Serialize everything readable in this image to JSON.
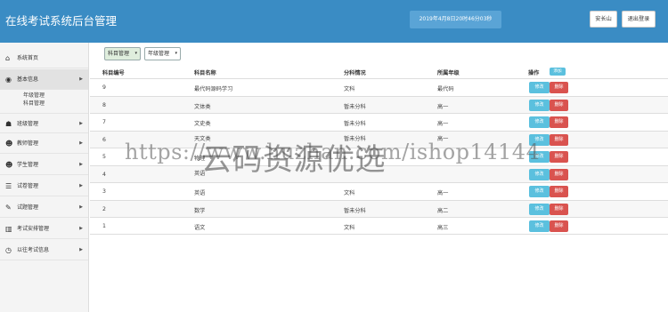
{
  "header": {
    "title": "在线考试系统后台管理",
    "datetime": "2019年4月8日20时46分03秒",
    "user_button": "安长山",
    "logout_button": "退出登录"
  },
  "sidebar": {
    "items": [
      {
        "label": "系统首页",
        "icon": "home-icon"
      },
      {
        "label": "基本信息",
        "icon": "info-icon",
        "subitems": [
          "年级管理",
          "科目管理"
        ]
      },
      {
        "label": "班级管理",
        "icon": "users-icon"
      },
      {
        "label": "教师管理",
        "icon": "teacher-icon"
      },
      {
        "label": "学生管理",
        "icon": "student-icon"
      },
      {
        "label": "试卷管理",
        "icon": "paper-icon"
      },
      {
        "label": "试题管理",
        "icon": "question-icon"
      },
      {
        "label": "考试安排管理",
        "icon": "schedule-icon"
      },
      {
        "label": "以往考试信息",
        "icon": "history-icon"
      }
    ]
  },
  "tabs": {
    "subject": "科目管理",
    "grade": "年级管理"
  },
  "table": {
    "headers": [
      "科目编号",
      "科目名称",
      "分科情况",
      "所属年级",
      "操作"
    ],
    "add_label": "添加",
    "edit_label": "修改",
    "delete_label": "删除",
    "rows": [
      {
        "id": "9",
        "name": "最代码源码学习",
        "division": "文科",
        "grade": "最代码"
      },
      {
        "id": "8",
        "name": "文体类",
        "division": "暂未分科",
        "grade": "高一"
      },
      {
        "id": "7",
        "name": "文史类",
        "division": "暂未分科",
        "grade": "高一"
      },
      {
        "id": "6",
        "name": "天文类",
        "division": "暂未分科",
        "grade": "高一"
      },
      {
        "id": "5",
        "name": "物理",
        "division": "",
        "grade": ""
      },
      {
        "id": "4",
        "name": "英语",
        "division": "",
        "grade": ""
      },
      {
        "id": "3",
        "name": "英语",
        "division": "文科",
        "grade": "高一"
      },
      {
        "id": "2",
        "name": "数学",
        "division": "暂未分科",
        "grade": "高二"
      },
      {
        "id": "1",
        "name": "语文",
        "division": "文科",
        "grade": "高三"
      }
    ]
  },
  "watermark": {
    "prefix": "https://www.huzhan.com/ishop14144",
    "cn": "云码资源优选"
  }
}
